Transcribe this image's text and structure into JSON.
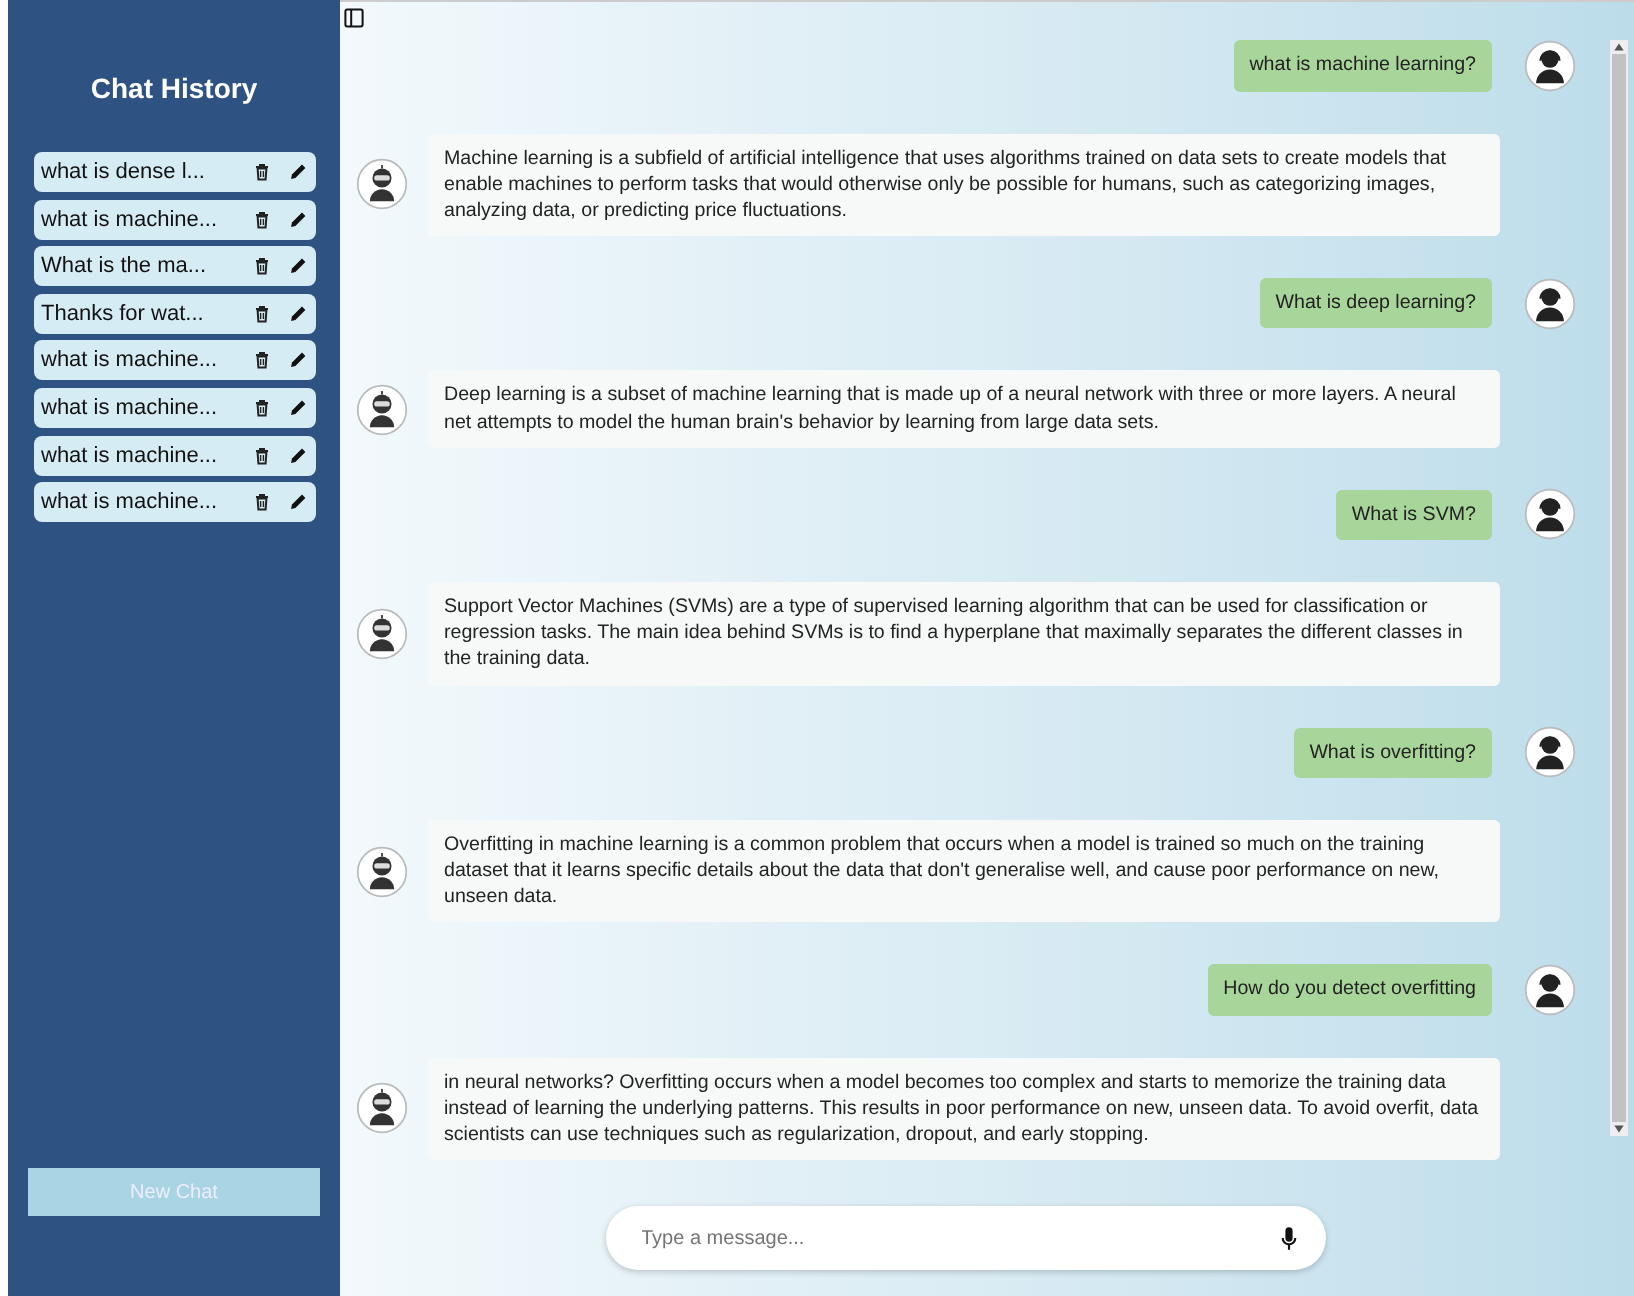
{
  "sidebar": {
    "title": "Chat History",
    "items": [
      {
        "label": "what is dense l..."
      },
      {
        "label": "what is machine..."
      },
      {
        "label": "What is the ma..."
      },
      {
        "label": "Thanks for wat..."
      },
      {
        "label": "what is machine..."
      },
      {
        "label": "what is machine..."
      },
      {
        "label": "what is machine..."
      },
      {
        "label": "what is machine..."
      }
    ],
    "new_chat_button": "New Chat"
  },
  "messages": [
    {
      "kind": "user",
      "text": "what is machine learning?"
    },
    {
      "kind": "bot",
      "text": "Machine learning is a subfield of artificial intelligence that uses algorithms trained on data sets to create models that enable machines to perform tasks that would otherwise only be possible for humans, such as categorizing images, analyzing data, or predicting price fluctuations."
    },
    {
      "kind": "user",
      "text": "What is deep learning?"
    },
    {
      "kind": "bot",
      "text": "Deep learning is a subset of machine learning that is made up of a neural network with three or more layers. A neural net attempts to model the human brain's behavior by learning from large data sets."
    },
    {
      "kind": "user",
      "text": "What is SVM?"
    },
    {
      "kind": "bot",
      "text": "Support Vector Machines (SVMs) are a type of supervised learning algorithm that can be used for classification or regression tasks. The main idea behind SVMs is to find a hyperplane that maximally separates the different classes in the training data."
    },
    {
      "kind": "user",
      "text": "What is overfitting?"
    },
    {
      "kind": "bot",
      "text": "Overfitting in machine learning is a common problem that occurs when a model is trained so much on the training dataset that it learns specific details about the data that don't generalise well, and cause poor performance on new, unseen data."
    },
    {
      "kind": "user",
      "text": "How do you detect overfitting"
    },
    {
      "kind": "bot",
      "text": "in neural networks? Overfitting occurs when a model becomes too complex and starts to memorize the training data instead of learning the underlying patterns. This results in poor performance on new, unseen data. To avoid overfit, data scientists can use techniques such as regularization, dropout, and early stopping."
    }
  ],
  "input": {
    "placeholder": "Type a message..."
  }
}
